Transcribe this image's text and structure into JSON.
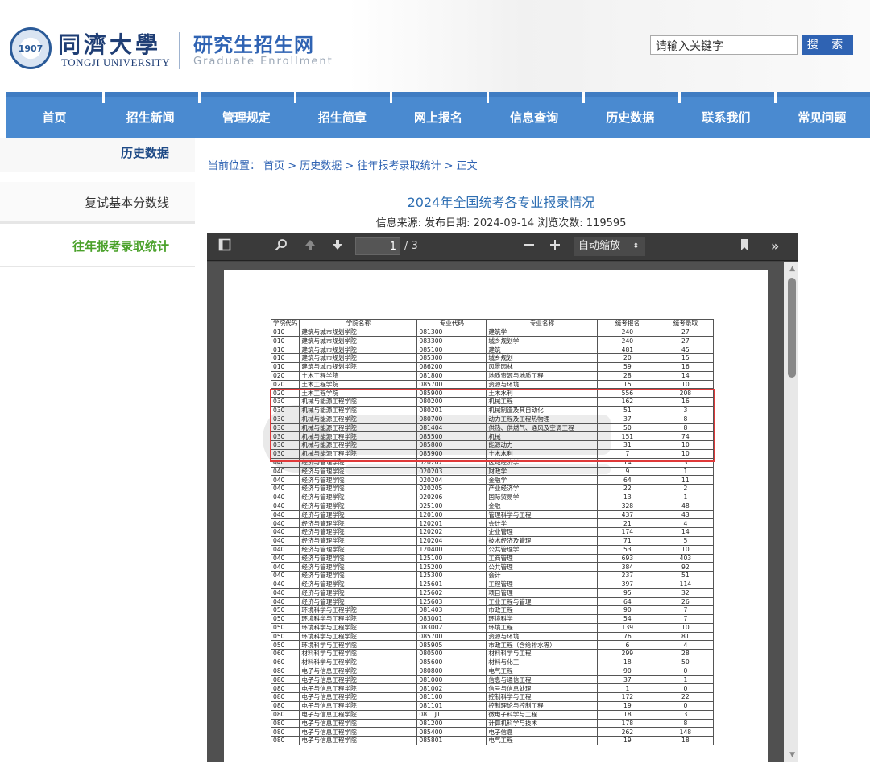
{
  "header": {
    "school_cn": "同濟大學",
    "school_en": "TONGJI UNIVERSITY",
    "site_cn": "研究生招生网",
    "site_en": "Graduate Enrollment",
    "search_value": "请输入关键字",
    "search_button": "搜 索"
  },
  "nav": [
    "首页",
    "招生新闻",
    "管理规定",
    "招生简章",
    "网上报名",
    "信息查询",
    "历史数据",
    "联系我们",
    "常见问题"
  ],
  "sidebar": {
    "title": "历史数据",
    "items": [
      {
        "label": "复试基本分数线"
      },
      {
        "label": "往年报考录取统计"
      }
    ]
  },
  "breadcrumb": "当前位置：  首页 > 历史数据 > 往年报考录取统计 > 正文",
  "article": {
    "title": "2024年全国统考各专业报录情况",
    "meta": "信息来源:  发布日期: 2024-09-14  浏览次数: 119595"
  },
  "viewer": {
    "page_current": "1",
    "page_total": "/ 3",
    "zoom": "自动缩放",
    "icons": [
      "sidebar-toggle-icon",
      "search-icon",
      "arrow-up-icon",
      "arrow-down-icon",
      "zoom-out-icon",
      "zoom-in-icon",
      "bookmark-icon",
      "more-tools-icon"
    ]
  },
  "table": {
    "headers": [
      "学院代码",
      "学院名称",
      "专业代码",
      "专业名称",
      "统考报名",
      "统考录取"
    ],
    "rows": [
      [
        "010",
        "建筑与城市规划学院",
        "081300",
        "建筑学",
        "240",
        "27"
      ],
      [
        "010",
        "建筑与城市规划学院",
        "083300",
        "城乡规划学",
        "240",
        "27"
      ],
      [
        "010",
        "建筑与城市规划学院",
        "085100",
        "建筑",
        "481",
        "45"
      ],
      [
        "010",
        "建筑与城市规划学院",
        "085300",
        "城乡规划",
        "20",
        "15"
      ],
      [
        "010",
        "建筑与城市规划学院",
        "086200",
        "风景园林",
        "59",
        "16"
      ],
      [
        "020",
        "土木工程学院",
        "081800",
        "地质资源与地质工程",
        "28",
        "14"
      ],
      [
        "020",
        "土木工程学院",
        "085700",
        "资源与环境",
        "15",
        "10"
      ],
      [
        "020",
        "土木工程学院",
        "085900",
        "土木水利",
        "556",
        "208"
      ],
      [
        "030",
        "机械与能源工程学院",
        "080200",
        "机械工程",
        "162",
        "16"
      ],
      [
        "030",
        "机械与能源工程学院",
        "080201",
        "机械制造及其自动化",
        "51",
        "3"
      ],
      [
        "030",
        "机械与能源工程学院",
        "080700",
        "动力工程及工程热物理",
        "37",
        "8"
      ],
      [
        "030",
        "机械与能源工程学院",
        "081404",
        "供热、供燃气、通风及空调工程",
        "50",
        "8"
      ],
      [
        "030",
        "机械与能源工程学院",
        "085500",
        "机械",
        "151",
        "74"
      ],
      [
        "030",
        "机械与能源工程学院",
        "085800",
        "能源动力",
        "31",
        "10"
      ],
      [
        "030",
        "机械与能源工程学院",
        "085900",
        "土木水利",
        "7",
        "10"
      ],
      [
        "040",
        "经济与管理学院",
        "020202",
        "区域经济学",
        "14",
        "3"
      ],
      [
        "040",
        "经济与管理学院",
        "020203",
        "财政学",
        "9",
        "1"
      ],
      [
        "040",
        "经济与管理学院",
        "020204",
        "金融学",
        "64",
        "11"
      ],
      [
        "040",
        "经济与管理学院",
        "020205",
        "产业经济学",
        "22",
        "2"
      ],
      [
        "040",
        "经济与管理学院",
        "020206",
        "国际贸易学",
        "13",
        "1"
      ],
      [
        "040",
        "经济与管理学院",
        "025100",
        "金融",
        "328",
        "48"
      ],
      [
        "040",
        "经济与管理学院",
        "120100",
        "管理科学与工程",
        "437",
        "43"
      ],
      [
        "040",
        "经济与管理学院",
        "120201",
        "会计学",
        "21",
        "4"
      ],
      [
        "040",
        "经济与管理学院",
        "120202",
        "企业管理",
        "174",
        "14"
      ],
      [
        "040",
        "经济与管理学院",
        "120204",
        "技术经济及管理",
        "71",
        "5"
      ],
      [
        "040",
        "经济与管理学院",
        "120400",
        "公共管理学",
        "53",
        "10"
      ],
      [
        "040",
        "经济与管理学院",
        "125100",
        "工商管理",
        "693",
        "403"
      ],
      [
        "040",
        "经济与管理学院",
        "125200",
        "公共管理",
        "384",
        "92"
      ],
      [
        "040",
        "经济与管理学院",
        "125300",
        "会计",
        "237",
        "51"
      ],
      [
        "040",
        "经济与管理学院",
        "125601",
        "工程管理",
        "397",
        "114"
      ],
      [
        "040",
        "经济与管理学院",
        "125602",
        "项目管理",
        "95",
        "32"
      ],
      [
        "040",
        "经济与管理学院",
        "125603",
        "工业工程与管理",
        "64",
        "26"
      ],
      [
        "050",
        "环境科学与工程学院",
        "081403",
        "市政工程",
        "90",
        "7"
      ],
      [
        "050",
        "环境科学与工程学院",
        "083001",
        "环境科学",
        "54",
        "7"
      ],
      [
        "050",
        "环境科学与工程学院",
        "083002",
        "环境工程",
        "139",
        "10"
      ],
      [
        "050",
        "环境科学与工程学院",
        "085700",
        "资源与环境",
        "76",
        "81"
      ],
      [
        "050",
        "环境科学与工程学院",
        "085905",
        "市政工程（含给排水等）",
        "6",
        "4"
      ],
      [
        "060",
        "材料科学与工程学院",
        "080500",
        "材料科学与工程",
        "299",
        "28"
      ],
      [
        "060",
        "材料科学与工程学院",
        "085600",
        "材料与化工",
        "18",
        "50"
      ],
      [
        "080",
        "电子与信息工程学院",
        "080800",
        "电气工程",
        "90",
        "0"
      ],
      [
        "080",
        "电子与信息工程学院",
        "081000",
        "信息与通信工程",
        "37",
        "1"
      ],
      [
        "080",
        "电子与信息工程学院",
        "081002",
        "信号与信息处理",
        "1",
        "0"
      ],
      [
        "080",
        "电子与信息工程学院",
        "081100",
        "控制科学与工程",
        "172",
        "22"
      ],
      [
        "080",
        "电子与信息工程学院",
        "081101",
        "控制理论与控制工程",
        "19",
        "0"
      ],
      [
        "080",
        "电子与信息工程学院",
        "0811J1",
        "微电子科学与工程",
        "18",
        "3"
      ],
      [
        "080",
        "电子与信息工程学院",
        "081200",
        "计算机科学与技术",
        "178",
        "8"
      ],
      [
        "080",
        "电子与信息工程学院",
        "085400",
        "电子信息",
        "262",
        "148"
      ],
      [
        "080",
        "电子与信息工程学院",
        "085801",
        "电气工程",
        "19",
        "18"
      ]
    ]
  }
}
